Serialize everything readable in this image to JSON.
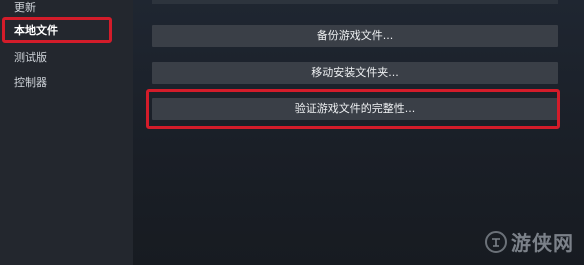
{
  "sidebar": {
    "items": [
      {
        "label": "更新"
      },
      {
        "label": "本地文件"
      },
      {
        "label": "测试版"
      },
      {
        "label": "控制器"
      }
    ]
  },
  "main": {
    "buttons": [
      {
        "label": "备份游戏文件..."
      },
      {
        "label": "移动安装文件夹..."
      },
      {
        "label": "验证游戏文件的完整性..."
      }
    ]
  },
  "watermark": {
    "text": "游侠网"
  },
  "colors": {
    "highlight": "#d31c2a",
    "button_bg": "#3a3f47",
    "sidebar_bg": "#23272e"
  }
}
